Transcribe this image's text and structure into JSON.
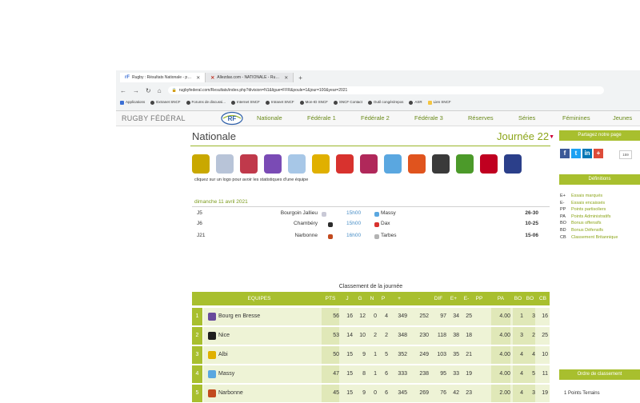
{
  "browser": {
    "tabs": [
      {
        "label": "Rugby : Résultats Nationale - p…",
        "active": true
      },
      {
        "label": "Allezdax.com - NATIONALE - Ru…",
        "active": false
      }
    ],
    "url": "rugbyfederal.com/Resultats/index.php?division=N1&ligue=FFR&poule=1&jour=100&year=2021",
    "bookmarks": [
      "Applications",
      "Extranet SNCF",
      "Forums de discussi...",
      "Internet SNCF",
      "Intranet SNCF",
      "Mon-ID SNCF",
      "SNCF Contact",
      "Outil congés/repos",
      "ASR",
      "Lien SNCF"
    ]
  },
  "site": {
    "brand": "RUGBY FÉDÉRAL",
    "logo_text": "RF",
    "nav": [
      "Nationale",
      "Fédérale 1",
      "Fédérale 2",
      "Fédérale 3",
      "Réserves",
      "Séries",
      "Féminines",
      "Jeunes"
    ]
  },
  "main": {
    "title": "Nationale",
    "journee": "Journée 22",
    "logo_hint": "cliquez sur un logo pour avoir les statistiques d'une équipe",
    "date": "dimanche 11 avril 2021",
    "matches": [
      {
        "code": "J5",
        "home": "Bourgoin Jallieu",
        "home_color": "#c9c9d6",
        "time": "15h00",
        "away": "Massy",
        "away_color": "#5aa7e0",
        "score": "26-30"
      },
      {
        "code": "J6",
        "home": "Chambéry",
        "home_color": "#2b2b2b",
        "time": "15h00",
        "away": "Dax",
        "away_color": "#d8322e",
        "score": "10-25"
      },
      {
        "code": "J21",
        "home": "Narbonne",
        "home_color": "#c24a1e",
        "time": "16h00",
        "away": "Tarbes",
        "away_color": "#b3b3b3",
        "score": "15-06"
      }
    ]
  },
  "standings": {
    "title": "Classement de la journée",
    "headers": [
      "EQUIPES",
      "PTS",
      "J",
      "G",
      "N",
      "P",
      "+",
      "-",
      "DIF",
      "E+",
      "E-",
      "PP",
      "PA",
      "BO",
      "BO",
      "CB"
    ],
    "rows": [
      {
        "rank": "1",
        "team": "Bourg en Bresse",
        "color": "#6a4b9c",
        "pts": "56",
        "j": "16",
        "g": "12",
        "n": "0",
        "p": "4",
        "plus": "349",
        "minus": "252",
        "dif": "97",
        "ep": "34",
        "em": "25",
        "pp": "",
        "pa": "4.00",
        "bo1": "1",
        "bo2": "3",
        "cb": "16"
      },
      {
        "rank": "2",
        "team": "Nice",
        "color": "#1f1f1f",
        "pts": "53",
        "j": "14",
        "g": "10",
        "n": "2",
        "p": "2",
        "plus": "348",
        "minus": "230",
        "dif": "118",
        "ep": "38",
        "em": "18",
        "pp": "",
        "pa": "4.00",
        "bo1": "3",
        "bo2": "2",
        "cb": "25"
      },
      {
        "rank": "3",
        "team": "Albi",
        "color": "#e0b000",
        "pts": "50",
        "j": "15",
        "g": "9",
        "n": "1",
        "p": "5",
        "plus": "352",
        "minus": "249",
        "dif": "103",
        "ep": "35",
        "em": "21",
        "pp": "",
        "pa": "4.00",
        "bo1": "4",
        "bo2": "4",
        "cb": "10"
      },
      {
        "rank": "4",
        "team": "Massy",
        "color": "#5aa7e0",
        "pts": "47",
        "j": "15",
        "g": "8",
        "n": "1",
        "p": "6",
        "plus": "333",
        "minus": "238",
        "dif": "95",
        "ep": "33",
        "em": "19",
        "pp": "",
        "pa": "4.00",
        "bo1": "4",
        "bo2": "5",
        "cb": "11"
      },
      {
        "rank": "5",
        "team": "Narbonne",
        "color": "#c24a1e",
        "pts": "45",
        "j": "15",
        "g": "9",
        "n": "0",
        "p": "6",
        "plus": "345",
        "minus": "269",
        "dif": "76",
        "ep": "42",
        "em": "23",
        "pp": "",
        "pa": "2.00",
        "bo1": "4",
        "bo2": "3",
        "cb": "19"
      }
    ]
  },
  "sidebar": {
    "share_title": "Partagez notre page",
    "social": [
      {
        "label": "f",
        "color": "#3b5998"
      },
      {
        "label": "t",
        "color": "#1da1f2"
      },
      {
        "label": "in",
        "color": "#0077b5"
      },
      {
        "label": "+",
        "color": "#dd4b39"
      }
    ],
    "share_count": "159",
    "defs_title": "Définitions",
    "definitions": [
      {
        "k": "E+",
        "d": "Essais marqués"
      },
      {
        "k": "E-",
        "d": "Essais encaissés"
      },
      {
        "k": "PP",
        "d": "Points partisoliers"
      },
      {
        "k": "PA",
        "d": "Points Administratifs"
      },
      {
        "k": "BO",
        "d": "Bonus offensifs"
      },
      {
        "k": "BD",
        "d": "Bonus Défensifs"
      },
      {
        "k": "CB",
        "d": "Classement Britannique"
      }
    ],
    "order_title": "Ordre de classement",
    "order_first": "1  Points Terrains"
  },
  "team_logos": [
    "#c9a800",
    "#b8c4d8",
    "#c0394b",
    "#7a4bb5",
    "#a7c7e7",
    "#e0b000",
    "#d8322e",
    "#b0285a",
    "#5aa7e0",
    "#e0541e",
    "#3a3a3a",
    "#4c9a2a",
    "#c00020",
    "#2b3f8a"
  ],
  "colors": {
    "accent": "#a8bf2e",
    "accent_text": "#8ca51a"
  }
}
